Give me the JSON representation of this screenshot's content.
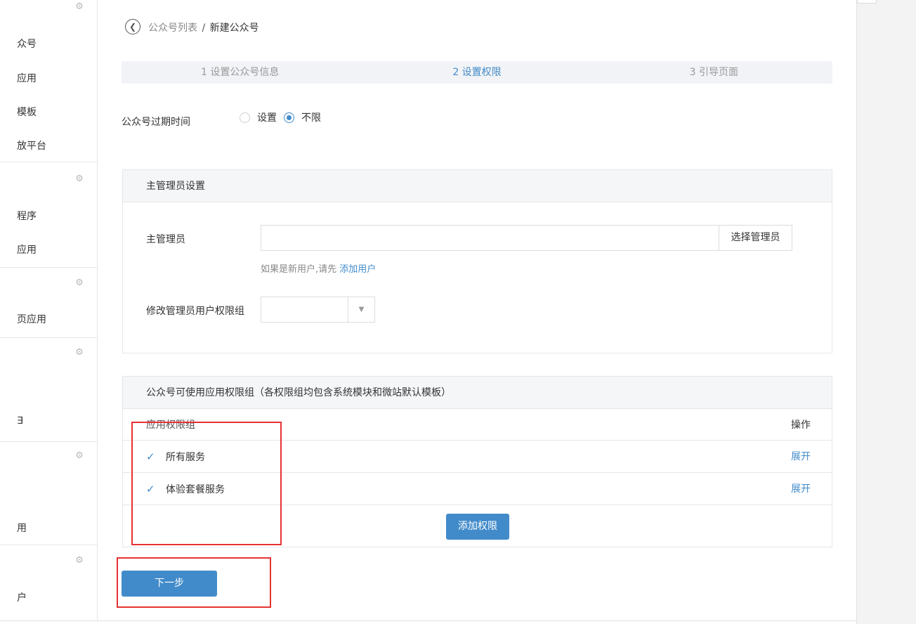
{
  "sidebar": {
    "items": [
      {
        "label": "众号"
      },
      {
        "label": "应用"
      },
      {
        "label": "模板"
      },
      {
        "label": "放平台"
      },
      {
        "label": "程序"
      },
      {
        "label": "应用"
      },
      {
        "label": "页应用"
      },
      {
        "label": "∃"
      },
      {
        "label": "用"
      },
      {
        "label": "户"
      }
    ],
    "gear_icon": "gear-icon"
  },
  "header": {
    "back_icon": "back-arrow-icon",
    "breadcrumb_link": "公众号列表",
    "breadcrumb_sep": "/",
    "breadcrumb_current": "新建公众号"
  },
  "steps": [
    {
      "label": "1 设置公众号信息",
      "active": false
    },
    {
      "label": "2 设置权限",
      "active": true
    },
    {
      "label": "3 引导页面",
      "active": false
    }
  ],
  "expiry": {
    "label": "公众号过期时间",
    "options": [
      {
        "label": "设置",
        "checked": false
      },
      {
        "label": "不限",
        "checked": true
      }
    ]
  },
  "admin_panel": {
    "title": "主管理员设置",
    "admin_label": "主管理员",
    "admin_value": "",
    "select_button": "选择管理员",
    "hint_text": "如果是新用户,请先",
    "hint_link": "添加用户",
    "group_label": "修改管理员用户权限组",
    "group_value": ""
  },
  "perm_panel": {
    "title": "公众号可使用应用权限组（各权限组均包含系统模块和微站默认模板）",
    "col_group": "应用权限组",
    "col_action": "操作",
    "rows": [
      {
        "name": "所有服务",
        "checked": true,
        "action": "展开"
      },
      {
        "name": "体验套餐服务",
        "checked": true,
        "action": "展开"
      }
    ],
    "add_button": "添加权限"
  },
  "footer": {
    "next_button": "下一步"
  },
  "colors": {
    "primary": "#428bca",
    "annotation": "#e63232"
  }
}
